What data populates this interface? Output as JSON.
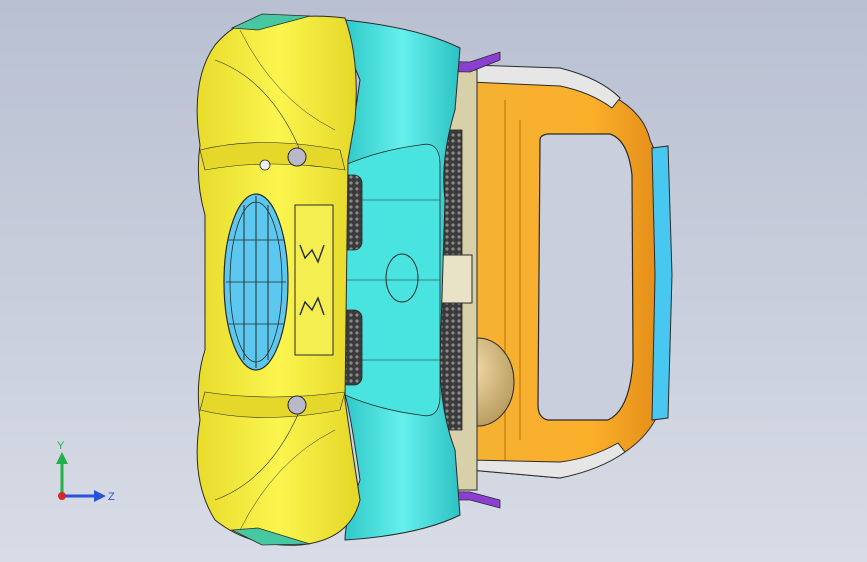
{
  "viewport": {
    "background_top": "#b9c0d2",
    "background_bottom": "#d8dce6"
  },
  "model": {
    "colors": {
      "body": "#f2ea3c",
      "body_shadow": "#d6c81e",
      "panel": "#4fe7e4",
      "panel_dark": "#27b9bd",
      "frame": "#f5a623",
      "frame_dark": "#d57c0f",
      "strip": "#48c8f0",
      "accent": "#8b3fd1",
      "grille_blue": "#5cc8ef",
      "sphere": "#d9c089",
      "wire": "#2a2a2a"
    }
  },
  "triad": {
    "y_label": "Y",
    "z_label": "Z",
    "y_color": "#1fb24a",
    "z_color": "#2a52d8",
    "x_color": "#d62828"
  }
}
